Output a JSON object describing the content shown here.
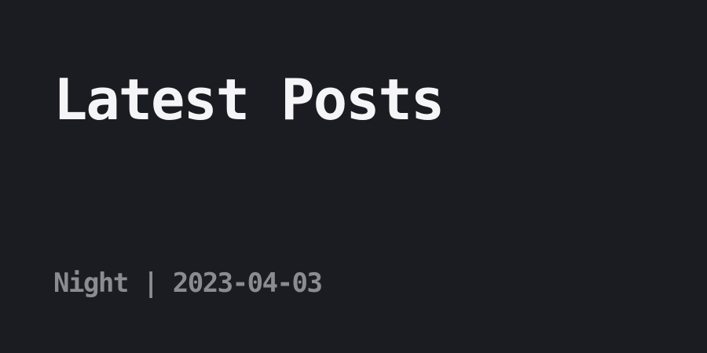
{
  "post": {
    "title": "Latest Posts",
    "meta_line": "Night | 2023-04-03"
  },
  "colors": {
    "background": "#1b1c22",
    "title_text": "#f5f5f7",
    "meta_text": "#8b8c92"
  }
}
